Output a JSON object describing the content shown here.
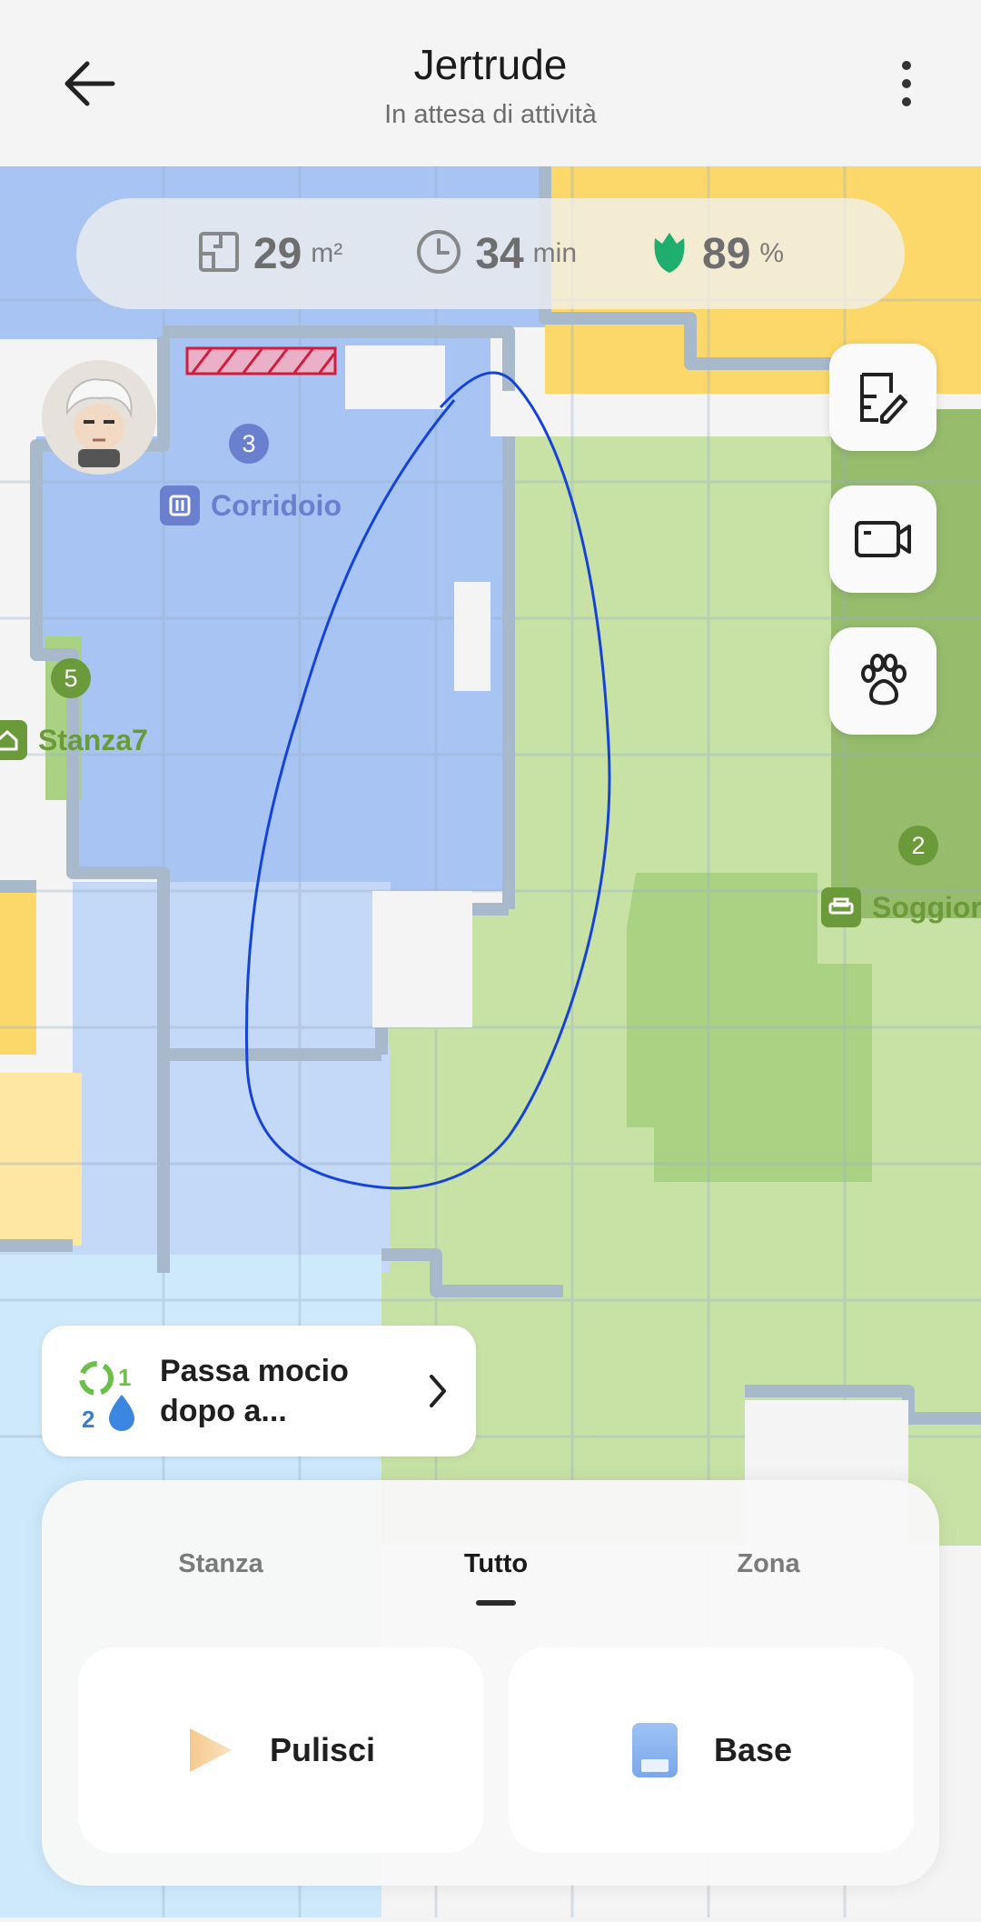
{
  "header": {
    "title": "Jertrude",
    "status": "In attesa di attività"
  },
  "stats": {
    "area_value": "29",
    "area_unit": "m²",
    "time_value": "34",
    "time_unit": "min",
    "battery_value": "89",
    "battery_unit": "%"
  },
  "rooms": [
    {
      "number": "3",
      "name": "Corridoio",
      "color": "#6b7fcf"
    },
    {
      "number": "5",
      "name": "Stanza7",
      "color": "#6a9a3a"
    },
    {
      "number": "2",
      "name": "Soggior",
      "color": "#6a9a3a"
    }
  ],
  "tip": {
    "text": "Passa mocio dopo a...",
    "icon_number_1": "1",
    "icon_number_2": "2"
  },
  "tabs": [
    "Stanza",
    "Tutto",
    "Zona"
  ],
  "active_tab": "Tutto",
  "actions": {
    "clean_label": "Pulisci",
    "dock_label": "Base"
  },
  "colors": {
    "blue_room": "#a8c4f2",
    "green_room": "#c8e2a6",
    "yellow_room": "#fcd86a",
    "wall": "#a8b9cc",
    "accent_green": "#1fae6e"
  }
}
